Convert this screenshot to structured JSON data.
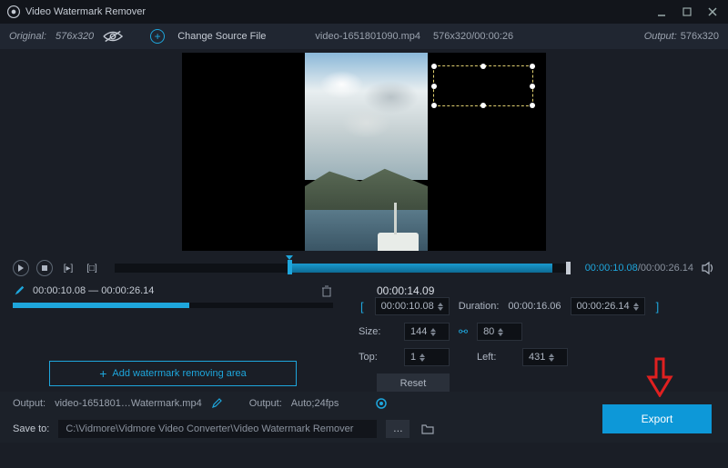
{
  "titlebar": {
    "title": "Video Watermark Remover"
  },
  "infobar": {
    "original_label": "Original:",
    "original_dims": "576x320",
    "change_source": "Change Source File",
    "filename": "video-1651801090.mp4",
    "file_dims": "576x320",
    "file_duration": "00:00:26",
    "output_label": "Output:",
    "output_dims": "576x320"
  },
  "playbar": {
    "current": "00:00:10.08",
    "total": "00:00:26.14"
  },
  "segment": {
    "start": "00:00:10.08",
    "end": "00:00:26.14",
    "add_label": "Add watermark removing area"
  },
  "params": {
    "pos_time": "00:00:14.09",
    "start_time": "00:00:10.08",
    "duration_label": "Duration:",
    "duration_val": "00:00:16.06",
    "end_time": "00:00:26.14",
    "size_label": "Size:",
    "size_w": "144",
    "size_h": "80",
    "top_label": "Top:",
    "top_val": "1",
    "left_label": "Left:",
    "left_val": "431",
    "reset": "Reset"
  },
  "output": {
    "label1": "Output:",
    "filename": "video-1651801…Watermark.mp4",
    "label2": "Output:",
    "settings": "Auto;24fps"
  },
  "save": {
    "label": "Save to:",
    "path": "C:\\Vidmore\\Vidmore Video Converter\\Video Watermark Remover"
  },
  "export": {
    "label": "Export"
  }
}
